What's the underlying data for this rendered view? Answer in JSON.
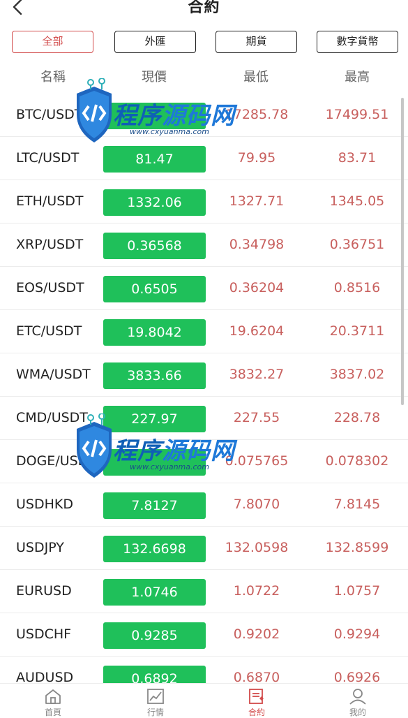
{
  "header": {
    "title": "合約",
    "back_icon": "chevron-left-icon"
  },
  "filters": [
    {
      "label": "全部",
      "active": true
    },
    {
      "label": "外匯",
      "active": false
    },
    {
      "label": "期貨",
      "active": false
    },
    {
      "label": "數字貨幣",
      "active": false
    }
  ],
  "columns": {
    "name": "名稱",
    "price": "現價",
    "low": "最低",
    "high": "最高"
  },
  "rows": [
    {
      "pair": "BTC/USDT",
      "price": "",
      "low": "17285.78",
      "high": "17499.51"
    },
    {
      "pair": "LTC/USDT",
      "price": "81.47",
      "low": "79.95",
      "high": "83.71"
    },
    {
      "pair": "ETH/USDT",
      "price": "1332.06",
      "low": "1327.71",
      "high": "1345.05"
    },
    {
      "pair": "XRP/USDT",
      "price": "0.36568",
      "low": "0.34798",
      "high": "0.36751"
    },
    {
      "pair": "EOS/USDT",
      "price": "0.6505",
      "low": "0.36204",
      "high": "0.8516"
    },
    {
      "pair": "ETC/USDT",
      "price": "19.8042",
      "low": "19.6204",
      "high": "20.3711"
    },
    {
      "pair": "WMA/USDT",
      "price": "3833.66",
      "low": "3832.27",
      "high": "3837.02"
    },
    {
      "pair": "CMD/USDT",
      "price": "227.97",
      "low": "227.55",
      "high": "228.78"
    },
    {
      "pair": "DOGE/USDT",
      "price": "",
      "low": "0.075765",
      "high": "0.078302"
    },
    {
      "pair": "USDHKD",
      "price": "7.8127",
      "low": "7.8070",
      "high": "7.8145"
    },
    {
      "pair": "USDJPY",
      "price": "132.6698",
      "low": "132.0598",
      "high": "132.8599"
    },
    {
      "pair": "EURUSD",
      "price": "1.0746",
      "low": "1.0722",
      "high": "1.0757"
    },
    {
      "pair": "USDCHF",
      "price": "0.9285",
      "low": "0.9202",
      "high": "0.9294"
    },
    {
      "pair": "AUDUSD",
      "price": "0.6892",
      "low": "0.6870",
      "high": "0.6926"
    }
  ],
  "tabbar": [
    {
      "icon": "home-icon",
      "label": "首頁",
      "active": false
    },
    {
      "icon": "chart-icon",
      "label": "行情",
      "active": false
    },
    {
      "icon": "contract-icon",
      "label": "合約",
      "active": true
    },
    {
      "icon": "user-icon",
      "label": "我的",
      "active": false
    }
  ],
  "watermark": {
    "text_a": "程序",
    "text_b": "源码网",
    "url": "www.cxyuanma.com"
  },
  "colors": {
    "accent": "#d24b4b",
    "price_green": "#1fc05a",
    "range_red": "#c8605e"
  }
}
